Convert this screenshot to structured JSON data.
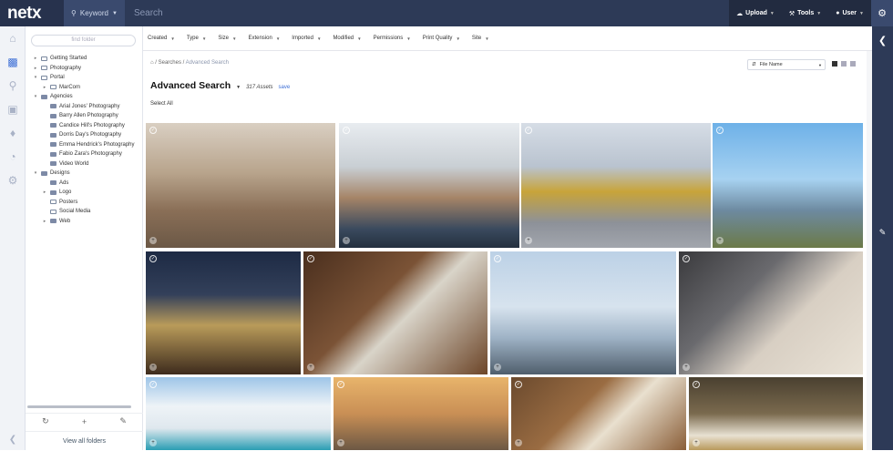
{
  "header": {
    "logo": "netx",
    "search_mode": "Keyword",
    "search_placeholder": "Search",
    "buttons": [
      {
        "icon": "cloud-upload-icon",
        "label": "Upload"
      },
      {
        "icon": "wrench-icon",
        "label": "Tools"
      },
      {
        "icon": "user-icon",
        "label": "User"
      }
    ]
  },
  "sidebar": {
    "find_placeholder": "find folder",
    "tree": [
      {
        "label": "Getting Started",
        "depth": 0,
        "arrow": "▸",
        "solid": false
      },
      {
        "label": "Photography",
        "depth": 0,
        "arrow": "▸",
        "solid": false
      },
      {
        "label": "Portal",
        "depth": 0,
        "arrow": "▾",
        "solid": false
      },
      {
        "label": "MarCom",
        "depth": 1,
        "arrow": "▸",
        "solid": false
      },
      {
        "label": "Agencies",
        "depth": 0,
        "arrow": "▾",
        "solid": true
      },
      {
        "label": "Arial Jones' Photography",
        "depth": 1,
        "arrow": "",
        "solid": true
      },
      {
        "label": "Barry Allen Photography",
        "depth": 1,
        "arrow": "",
        "solid": true
      },
      {
        "label": "Candice Hill's Photography",
        "depth": 1,
        "arrow": "",
        "solid": true
      },
      {
        "label": "Dorris Day's Photography",
        "depth": 1,
        "arrow": "",
        "solid": true
      },
      {
        "label": "Emma Hendrick's Photography",
        "depth": 1,
        "arrow": "",
        "solid": true
      },
      {
        "label": "Fabio Zara's Photography",
        "depth": 1,
        "arrow": "",
        "solid": true
      },
      {
        "label": "Video World",
        "depth": 1,
        "arrow": "",
        "solid": true
      },
      {
        "label": "Designs",
        "depth": 0,
        "arrow": "▾",
        "solid": true
      },
      {
        "label": "Ads",
        "depth": 1,
        "arrow": "",
        "solid": true
      },
      {
        "label": "Logo",
        "depth": 1,
        "arrow": "▸",
        "solid": true
      },
      {
        "label": "Posters",
        "depth": 1,
        "arrow": "",
        "solid": false
      },
      {
        "label": "Social Media",
        "depth": 1,
        "arrow": "",
        "solid": false
      },
      {
        "label": "Web",
        "depth": 1,
        "arrow": "▸",
        "solid": true
      }
    ],
    "view_all": "View all folders"
  },
  "filters": [
    "Created",
    "Type",
    "Size",
    "Extension",
    "Imported",
    "Modified",
    "Permissions",
    "Print Quality",
    "Site"
  ],
  "main": {
    "breadcrumb_mid": "/ Searches /",
    "breadcrumb_current": "Advanced Search",
    "sort_label": "File Name",
    "title": "Advanced Search",
    "count": "317 Assets",
    "save": "save",
    "select_all": "Select All"
  }
}
